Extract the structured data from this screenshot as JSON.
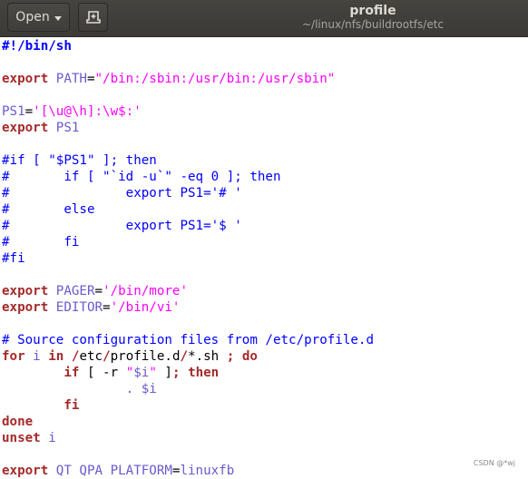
{
  "titlebar": {
    "open_label": "Open",
    "file_name": "profile",
    "file_path": "~/linux/nfs/buildrootfs/etc"
  },
  "editor": {
    "lines": [
      [
        {
          "t": "#!/bin/sh",
          "c": "sb2"
        }
      ],
      [],
      [
        {
          "t": "export",
          "c": "kw"
        },
        {
          "t": " "
        },
        {
          "t": "PATH",
          "c": "var"
        },
        {
          "t": "="
        },
        {
          "t": "\"/bin:/sbin:/usr/bin:/usr/sbin\"",
          "c": "str"
        }
      ],
      [],
      [
        {
          "t": "PS1",
          "c": "var"
        },
        {
          "t": "="
        },
        {
          "t": "'[\\u@\\h]:\\w$:'",
          "c": "str"
        }
      ],
      [
        {
          "t": "export",
          "c": "kw"
        },
        {
          "t": " "
        },
        {
          "t": "PS1",
          "c": "var"
        }
      ],
      [],
      [
        {
          "t": "#if [ \"$PS1\" ]; then",
          "c": "cm"
        }
      ],
      [
        {
          "t": "#       if [ \"`id -u`\" -eq 0 ]; then",
          "c": "cm"
        }
      ],
      [
        {
          "t": "#               export PS1='# '",
          "c": "cm"
        }
      ],
      [
        {
          "t": "#       else",
          "c": "cm"
        }
      ],
      [
        {
          "t": "#               export PS1='$ '",
          "c": "cm"
        }
      ],
      [
        {
          "t": "#       fi",
          "c": "cm"
        }
      ],
      [
        {
          "t": "#fi",
          "c": "cm"
        }
      ],
      [],
      [
        {
          "t": "export",
          "c": "kw"
        },
        {
          "t": " "
        },
        {
          "t": "PAGER",
          "c": "var"
        },
        {
          "t": "="
        },
        {
          "t": "'/bin/more'",
          "c": "str"
        }
      ],
      [
        {
          "t": "export",
          "c": "kw"
        },
        {
          "t": " "
        },
        {
          "t": "EDITOR",
          "c": "var"
        },
        {
          "t": "="
        },
        {
          "t": "'/bin/vi'",
          "c": "str"
        }
      ],
      [],
      [
        {
          "t": "# Source configuration files from /etc/profile.d",
          "c": "cm"
        }
      ],
      [
        {
          "t": "for",
          "c": "kw"
        },
        {
          "t": " "
        },
        {
          "t": "i",
          "c": "var"
        },
        {
          "t": " "
        },
        {
          "t": "in",
          "c": "kw"
        },
        {
          "t": " "
        },
        {
          "t": "/",
          "c": "kw"
        },
        {
          "t": "etc"
        },
        {
          "t": "/",
          "c": "kw"
        },
        {
          "t": "profile.d"
        },
        {
          "t": "/",
          "c": "kw"
        },
        {
          "t": "*.sh "
        },
        {
          "t": ";",
          "c": "kw"
        },
        {
          "t": " "
        },
        {
          "t": "do",
          "c": "kw"
        }
      ],
      [
        {
          "t": "        "
        },
        {
          "t": "if",
          "c": "kw"
        },
        {
          "t": " [ -r "
        },
        {
          "t": "\"",
          "c": "str"
        },
        {
          "t": "$i",
          "c": "var"
        },
        {
          "t": "\"",
          "c": "str"
        },
        {
          "t": " ]"
        },
        {
          "t": ";",
          "c": "kw"
        },
        {
          "t": " "
        },
        {
          "t": "then",
          "c": "kw"
        }
      ],
      [
        {
          "t": "                "
        },
        {
          "t": ".",
          "c": "var"
        },
        {
          "t": " "
        },
        {
          "t": "$i",
          "c": "var"
        }
      ],
      [
        {
          "t": "        "
        },
        {
          "t": "fi",
          "c": "kw"
        }
      ],
      [
        {
          "t": "done",
          "c": "kw"
        }
      ],
      [
        {
          "t": "unset",
          "c": "kw"
        },
        {
          "t": " "
        },
        {
          "t": "i",
          "c": "var"
        }
      ],
      [],
      [
        {
          "t": "export",
          "c": "kw"
        },
        {
          "t": " "
        },
        {
          "t": "QT QPA PLATFORM",
          "c": "var"
        },
        {
          "t": "="
        },
        {
          "t": "linuxfb",
          "c": "var"
        }
      ]
    ]
  },
  "watermark": "CSDN @*wj"
}
